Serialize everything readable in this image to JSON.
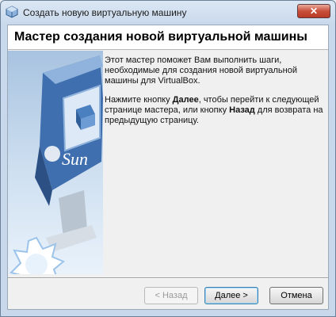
{
  "window": {
    "title": "Создать новую виртуальную машину",
    "close_label": "✕"
  },
  "header": {
    "title": "Мастер создания новой виртуальной машины"
  },
  "content": {
    "p1": "Этот мастер поможет Вам выполнить шаги, необходимые для создания новой виртуальной машины для VirtualBox.",
    "p2_part1": "Нажмите кнопку ",
    "p2_bold1": "Далее",
    "p2_part2": ", чтобы перейти к следующей странице мастера, или кнопку ",
    "p2_bold2": "Назад",
    "p2_part3": " для возврата на предыдущую страницу."
  },
  "banner": {
    "logo_text": "Sun"
  },
  "buttons": {
    "back": "< Назад",
    "next": "Далее >",
    "cancel": "Отмена"
  },
  "colors": {
    "accent": "#3c7fb1",
    "close": "#c94f3b"
  },
  "icons": {
    "app": "virtualbox-icon",
    "close": "close-icon"
  }
}
